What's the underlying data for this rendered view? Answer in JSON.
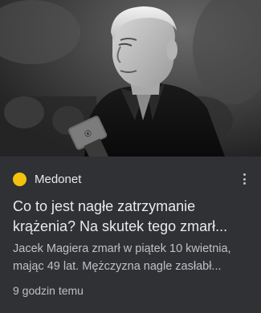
{
  "card": {
    "image_alt": "",
    "source": {
      "name": "Medonet",
      "favicon_color": "#f4c20d",
      "menu_icon": "more-vert-icon"
    },
    "headline_line1": "Co to jest nagłe zatrzymanie",
    "headline_line2": "krążenia? Na skutek tego zmarł...",
    "snippet_line1": "Jacek Magiera zmarł w piątek 10 kwietnia,",
    "snippet_line2": "mając 49 lat. Mężczyzna nagle zasłabł...",
    "time": "9 godzin temu"
  },
  "colors": {
    "card_background": "#303134",
    "headline": "#e8eaed",
    "secondary_text": "#bdc1c6"
  }
}
